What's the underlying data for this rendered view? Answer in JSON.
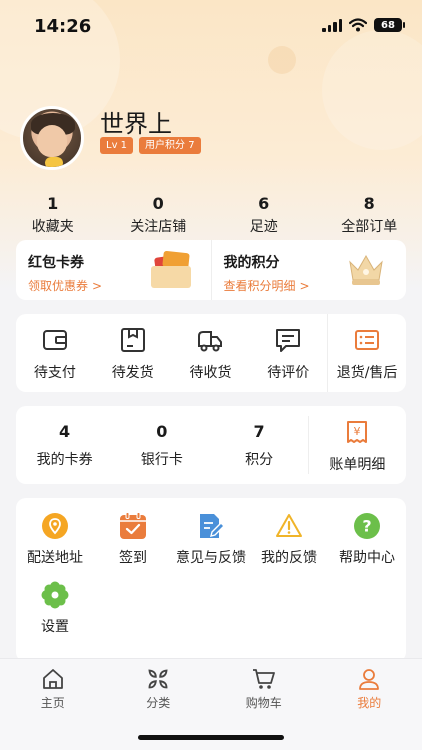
{
  "status_bar": {
    "time": "14:26",
    "battery": "68"
  },
  "profile": {
    "name": "世界上",
    "level_tag": "Lv 1",
    "points_tag": "用户积分 7"
  },
  "stats": [
    {
      "value": "1",
      "label": "收藏夹"
    },
    {
      "value": "0",
      "label": "关注店铺"
    },
    {
      "value": "6",
      "label": "足迹"
    },
    {
      "value": "8",
      "label": "全部订单"
    }
  ],
  "coupon_card": {
    "left_title": "红包卡券",
    "left_link": "领取优惠券",
    "right_title": "我的积分",
    "right_link": "查看积分明细"
  },
  "orders": [
    {
      "label": "待支付",
      "icon": "wallet-icon"
    },
    {
      "label": "待发货",
      "icon": "package-icon"
    },
    {
      "label": "待收货",
      "icon": "truck-icon"
    },
    {
      "label": "待评价",
      "icon": "comment-icon"
    },
    {
      "label": "退货/售后",
      "icon": "return-list-icon"
    }
  ],
  "assets": [
    {
      "value": "4",
      "label": "我的卡券"
    },
    {
      "value": "0",
      "label": "银行卡"
    },
    {
      "value": "7",
      "label": "积分"
    }
  ],
  "bill": {
    "label": "账单明细",
    "icon": "yen-bill-icon"
  },
  "tools": [
    {
      "label": "配送地址",
      "icon": "location-pin-icon"
    },
    {
      "label": "签到",
      "icon": "calendar-check-icon"
    },
    {
      "label": "意见与反馈",
      "icon": "feedback-doc-icon"
    },
    {
      "label": "我的反馈",
      "icon": "warning-icon"
    },
    {
      "label": "帮助中心",
      "icon": "help-icon"
    },
    {
      "label": "设置",
      "icon": "settings-gear-icon"
    }
  ],
  "tabbar": [
    {
      "label": "主页",
      "icon": "home-icon"
    },
    {
      "label": "分类",
      "icon": "category-icon"
    },
    {
      "label": "购物车",
      "icon": "cart-icon"
    },
    {
      "label": "我的",
      "icon": "user-icon"
    }
  ],
  "colors": {
    "accent": "#ea7c3c",
    "header_bg": "#fbe6c6",
    "page_bg": "#f4f4f6"
  }
}
